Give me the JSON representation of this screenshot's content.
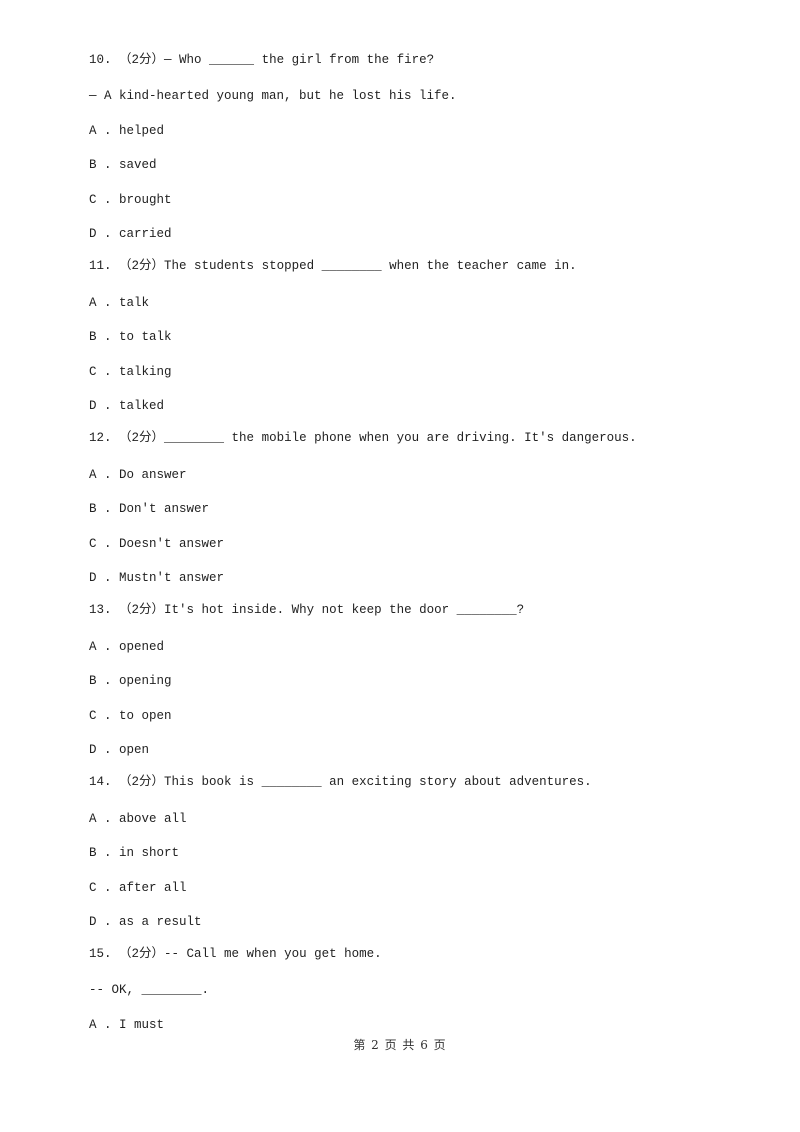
{
  "questions": [
    {
      "number": "10.",
      "score": "（2分）",
      "stem": "— Who ______ the girl from the fire?",
      "stem_line2": "— A kind-hearted young man, but he lost his life.",
      "options": [
        {
          "letter": "A",
          "text": "helped"
        },
        {
          "letter": "B",
          "text": "saved"
        },
        {
          "letter": "C",
          "text": "brought"
        },
        {
          "letter": "D",
          "text": "carried"
        }
      ]
    },
    {
      "number": "11.",
      "score": "（2分）",
      "stem": "The students stopped ________ when the teacher came in.",
      "options": [
        {
          "letter": "A",
          "text": "talk"
        },
        {
          "letter": "B",
          "text": "to talk"
        },
        {
          "letter": "C",
          "text": "talking"
        },
        {
          "letter": "D",
          "text": "talked"
        }
      ]
    },
    {
      "number": "12.",
      "score": "（2分）",
      "stem": "________ the mobile phone when you are driving. It's dangerous.",
      "options": [
        {
          "letter": "A",
          "text": "Do answer"
        },
        {
          "letter": "B",
          "text": "Don't answer"
        },
        {
          "letter": "C",
          "text": "Doesn't answer"
        },
        {
          "letter": "D",
          "text": "Mustn't answer"
        }
      ]
    },
    {
      "number": "13.",
      "score": "（2分）",
      "stem": "It's hot inside. Why not keep the door ________?",
      "options": [
        {
          "letter": "A",
          "text": "opened"
        },
        {
          "letter": "B",
          "text": "opening"
        },
        {
          "letter": "C",
          "text": "to open"
        },
        {
          "letter": "D",
          "text": "open"
        }
      ]
    },
    {
      "number": "14.",
      "score": "（2分）",
      "stem": "This book is ________ an exciting story about adventures.",
      "options": [
        {
          "letter": "A",
          "text": "above all"
        },
        {
          "letter": "B",
          "text": "in short"
        },
        {
          "letter": "C",
          "text": "after all"
        },
        {
          "letter": "D",
          "text": "as a result"
        }
      ]
    },
    {
      "number": "15.",
      "score": "（2分）",
      "stem": "-- Call me when you get home.",
      "stem_line2": "-- OK, ________.",
      "options": [
        {
          "letter": "A",
          "text": "I must"
        }
      ]
    }
  ],
  "footer": {
    "page_label": "第 2 页 共 6 页"
  }
}
